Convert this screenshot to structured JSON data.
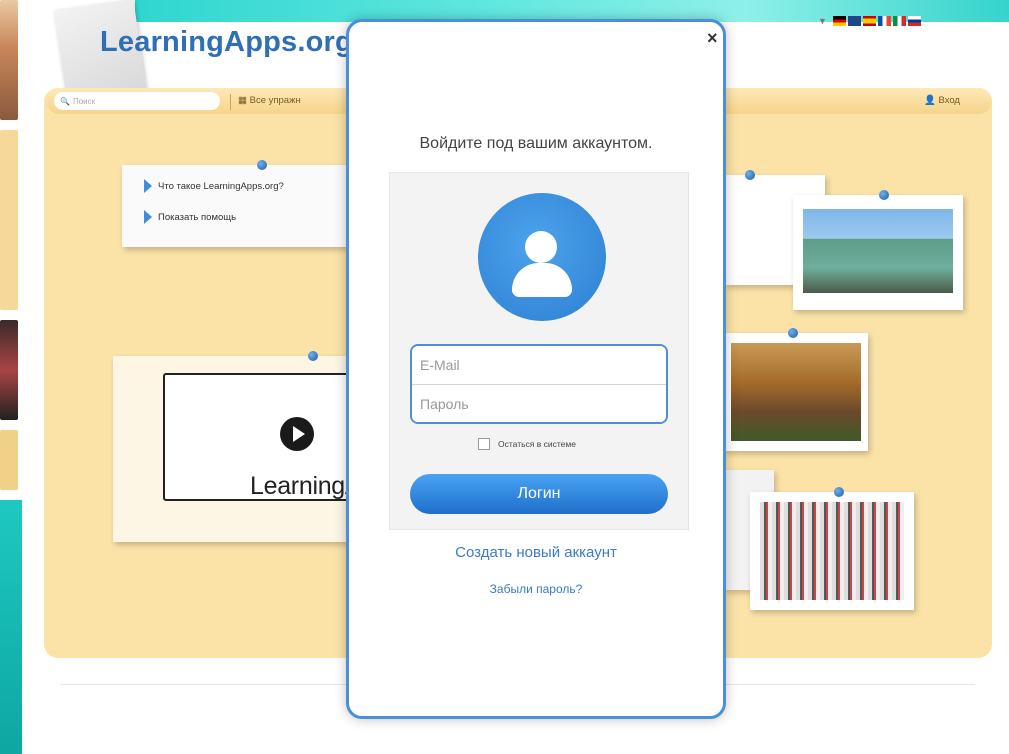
{
  "header": {
    "logo_text": "LearningApps.org",
    "languages": [
      "de",
      "gb",
      "es",
      "fr",
      "it",
      "ru"
    ]
  },
  "toolbar": {
    "search_placeholder": "Поиск",
    "all_exercises_label": "Все упражн",
    "login_label": "Вход"
  },
  "help": {
    "items": [
      "Что такое LearningApps.org?",
      "Показать помощь"
    ]
  },
  "video": {
    "title": "LearningApp"
  },
  "modal": {
    "close_glyph": "×",
    "title": "Войдите под вашим аккаунтом.",
    "email_placeholder": "E-Mail",
    "password_placeholder": "Пароль",
    "remember_label": "Остаться в системе",
    "login_button": "Логин",
    "create_account": "Создать новый аккаунт",
    "forgot_password": "Забыли пароль?"
  },
  "colors": {
    "accent": "#2c7fd2",
    "board": "#fbe3a8",
    "teal": "#2fd6cf"
  }
}
